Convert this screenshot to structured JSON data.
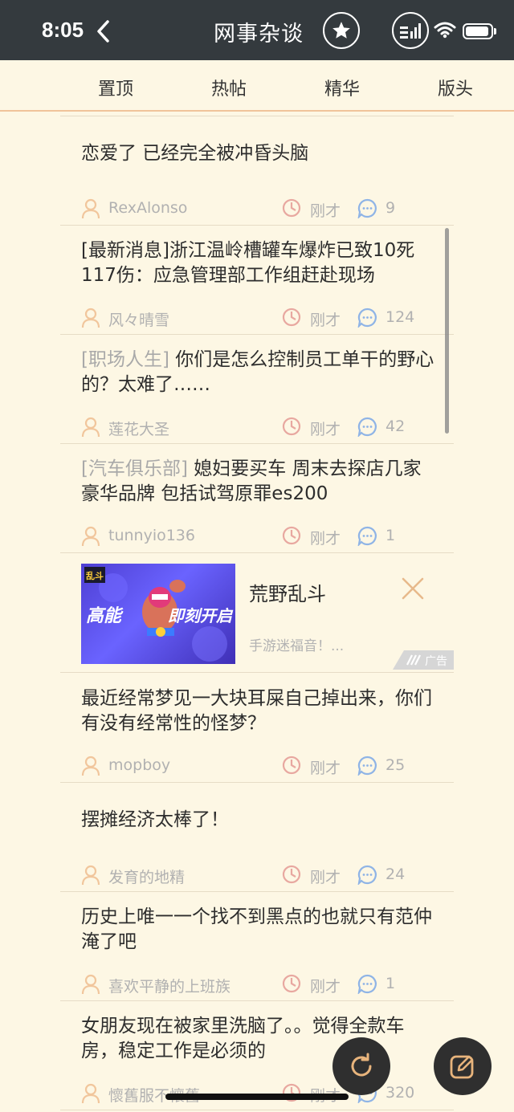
{
  "status_bar": {
    "time": "8:05"
  },
  "nav": {
    "title": "网事杂谈"
  },
  "tabs": [
    {
      "label": "置顶"
    },
    {
      "label": "热帖"
    },
    {
      "label": "精华"
    },
    {
      "label": "版头"
    }
  ],
  "posts": [
    {
      "tag": "",
      "title": "恋爱了 已经完全被冲昏头脑",
      "author": "RexAlonso",
      "time": "刚才",
      "count": "9"
    },
    {
      "tag": "",
      "title": "[最新消息]浙江温岭槽罐车爆炸已致10死117伤：应急管理部工作组赶赴现场",
      "author": "风々晴雪",
      "time": "刚才",
      "count": "124"
    },
    {
      "tag": "[职场人生]",
      "title": "你们是怎么控制员工单干的野心的？太难了……",
      "author": "莲花大圣",
      "time": "刚才",
      "count": "42"
    },
    {
      "tag": "[汽车俱乐部]",
      "title": "媳妇要买车 周末去探店几家豪华品牌 包括试驾原罪es200",
      "author": "tunnyio136",
      "time": "刚才",
      "count": "1"
    },
    {
      "tag": "",
      "title": "最近经常梦见一大块耳屎自己掉出来，你们有没有经常性的怪梦？",
      "author": "mopboy",
      "time": "刚才",
      "count": "25"
    },
    {
      "tag": "",
      "title": "摆摊经济太棒了！",
      "author": "发育的地精",
      "time": "刚才",
      "count": "24"
    },
    {
      "tag": "",
      "title": "历史上唯一一个找不到黑点的也就只有范仲淹了吧",
      "author": "喜欢平静的上班族",
      "time": "刚才",
      "count": "1"
    },
    {
      "tag": "",
      "title": "女朋友现在被家里洗脑了。。觉得全款车房，稳定工作是必须的",
      "author": "懷舊服不懷舊",
      "time": "刚才",
      "count": "320"
    }
  ],
  "ad": {
    "title": "荒野乱斗",
    "description": "手游迷福音！...",
    "badge": "广告",
    "image_text_left": "高能",
    "image_text_right": "即刻开启",
    "image_logo": "乱斗"
  },
  "colors": {
    "background": "#fdf7e4",
    "topbar": "#343a3e",
    "accent_orange": "#f0c39a",
    "icon_user": "#f1c69c",
    "icon_clock": "#e8a8a0",
    "icon_comment": "#8fb4e6"
  },
  "icons": {
    "back": "chevron-left-icon",
    "favorite": "star-icon",
    "signal": "signal-icon",
    "wifi": "wifi-icon",
    "battery": "battery-icon",
    "user": "user-icon",
    "clock": "clock-icon",
    "comment": "comment-icon",
    "close": "close-icon",
    "refresh": "refresh-icon",
    "compose": "compose-icon"
  }
}
